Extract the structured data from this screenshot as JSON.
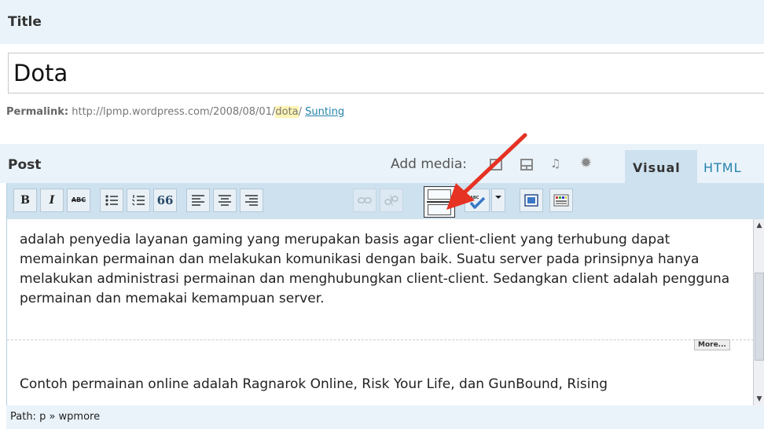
{
  "title_section": {
    "label": "Title",
    "value": "Dota"
  },
  "permalink": {
    "label": "Permalink:",
    "url_prefix": " http://lpmp.wordpress.com/2008/08/01/",
    "slug": "dota",
    "slash": "/ ",
    "edit_label": "Sunting"
  },
  "post_section": {
    "label": "Post",
    "add_media_label": "Add media:",
    "media_icons": [
      "image-icon",
      "video-icon",
      "audio-icon",
      "media-icon"
    ],
    "tabs": {
      "visual": "Visual",
      "html": "HTML"
    }
  },
  "toolbar": {
    "bold": "B",
    "italic": "I",
    "strike": "ABC",
    "blockquote": "66",
    "buttons": [
      "bold",
      "italic",
      "strikethrough",
      "bulleted-list",
      "numbered-list",
      "blockquote",
      "align-left",
      "align-center",
      "align-right",
      "insert-link",
      "remove-link",
      "insert-more",
      "spellcheck",
      "spellcheck-menu",
      "fullscreen",
      "kitchen-sink"
    ]
  },
  "editor": {
    "paragraph1": "adalah penyedia layanan gaming yang merupakan basis agar client-client yang terhubung dapat memainkan permainan dan melakukan komunikasi dengan baik. Suatu server pada prinsipnya hanya melakukan administrasi permainan dan menghubungkan client-client. Sedangkan client adalah pengguna permainan dan memakai kemampuan server.",
    "more_tag": "More...",
    "paragraph2": "Contoh permainan online adalah Ragnarok Online, Risk Your Life, dan GunBound, Rising"
  },
  "path": {
    "text": "Path: p » wpmore"
  },
  "colors": {
    "panel": "#eaf3fa",
    "toolbar": "#cee1ef",
    "link": "#2583ad",
    "annotation_arrow": "#e53222"
  }
}
